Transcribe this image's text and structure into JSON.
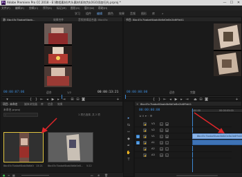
{
  "window": {
    "title": "Adobe Premiere Pro CC 2018 - E:\\教程素材\\片头素材\\如何为LOGO添加扫光.prproj *",
    "minimize_label": "—",
    "maximize_label": "☐",
    "close_label": "✕"
  },
  "menu": [
    "文件(F)",
    "编辑(E)",
    "剪辑(C)",
    "序列(S)",
    "标记(M)",
    "图形(G)",
    "窗口(W)",
    "帮助(H)"
  ],
  "workspaces": {
    "items": [
      "学习",
      "组件",
      "编辑",
      "颜色",
      "效果",
      "音频",
      "图形",
      "库"
    ],
    "active": "编辑",
    "more": "»"
  },
  "source_monitor": {
    "tabs": [
      "源: 8bc45c7babaf4bab...",
      "效果控件",
      "音频剪辑混合器: 8bc45c"
    ],
    "timecode_in": "00:00:07:06",
    "timecode_out": "00:00:13:21",
    "fit": "适合",
    "fraction": "1/2"
  },
  "program_monitor": {
    "tab": "节目: 8bc45c7babaf4bab0b6d0e8e2b6f9d41",
    "timecode_in": "00:00:00:00",
    "fit": "适合",
    "fraction": "完整"
  },
  "project_panel": {
    "tabs": [
      "项目: 未命名",
      "媒体浏览器",
      "库",
      "信息",
      "效果"
    ],
    "path": "未命名.prproj",
    "search_placeholder": "搜索",
    "status": "1 项已选择, 共 2 项",
    "items": [
      {
        "name": "8bc45c7babaf4bab0b6d0e8...",
        "duration": "13:21"
      },
      {
        "name": "8bc45c7babaf4bab0b6d0e8...",
        "duration": "5:22"
      }
    ]
  },
  "tools": [
    "▸",
    "⇆",
    "⇿",
    "◆",
    "✒",
    "✋",
    "T"
  ],
  "timeline": {
    "tab": "8bc45c7babaf4bab0b6d0e8e2b6f9d41",
    "timecode": "00:00:00:00",
    "ruler_start": ":00:00",
    "ruler_mid": "00:00:05:00",
    "tracks": [
      {
        "name": "V3",
        "type": "video"
      },
      {
        "name": "V2",
        "type": "video"
      },
      {
        "name": "V1",
        "type": "video"
      },
      {
        "name": "A1",
        "type": "audio"
      },
      {
        "name": "A2",
        "type": "audio"
      },
      {
        "name": "A3",
        "type": "audio"
      }
    ],
    "clips": [
      {
        "label": "8bc45c7babaf4bab0b6d0e8e2b6f9d41.mp4 [V]",
        "track": "V1"
      },
      {
        "label": "",
        "track": "A1"
      }
    ]
  },
  "colors": {
    "accent": "#3d8ad6",
    "arrow": "#e0262a",
    "clip_video": "#8ab4e8",
    "clip_audio": "#3e73b6"
  }
}
